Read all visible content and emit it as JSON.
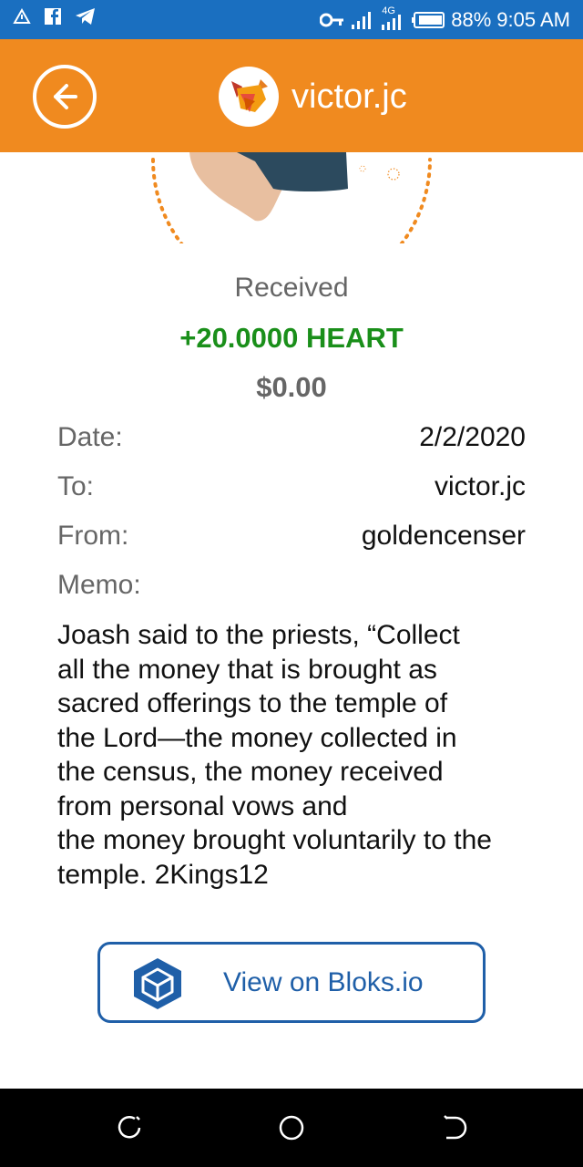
{
  "status_bar": {
    "left_icons": [
      "alert-triangle-icon",
      "facebook-icon",
      "telegram-icon"
    ],
    "right_icons": [
      "vpn-key-icon",
      "signal-icon",
      "signal-4g-icon",
      "battery-icon"
    ],
    "network_label": "4G",
    "battery": "88%",
    "time": "9:05 AM"
  },
  "header": {
    "back_icon": "arrow-left-circle-icon",
    "avatar_icon": "fox-logo-icon",
    "title": "victor.jc",
    "color": "#f08a1f"
  },
  "transaction": {
    "status": "Received",
    "amount": "+20.0000 HEART",
    "fiat": "$0.00",
    "amount_color": "#1a8f1a"
  },
  "details": [
    {
      "label": "Date:",
      "value": "2/2/2020"
    },
    {
      "label": "To:",
      "value": "victor.jc"
    },
    {
      "label": "From:",
      "value": "goldencenser"
    },
    {
      "label": "Memo:",
      "value": ""
    }
  ],
  "memo_lines": [
    "Joash said to the priests, “Collect",
    "all the money that is brought as",
    "sacred offerings to the temple of",
    "the Lord—the money collected in",
    "the census, the money received",
    "from personal vows and",
    "the money brought voluntarily to the",
    "temple. 2Kings12"
  ],
  "action": {
    "label": "View on Bloks.io",
    "icon": "cube-icon",
    "color": "#1f5fa8"
  },
  "nav_bar": {
    "buttons": [
      "recent-apps-icon",
      "home-icon",
      "back-icon"
    ]
  }
}
